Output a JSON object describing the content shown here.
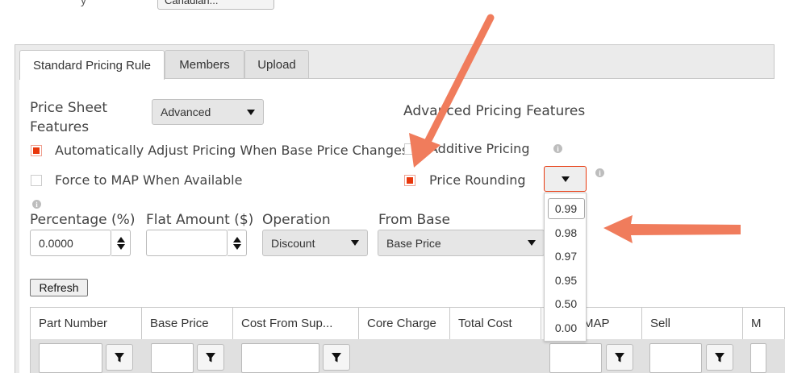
{
  "top": {
    "select_value": "Canadian..."
  },
  "tabs": [
    {
      "label": "Standard Pricing Rule",
      "active": true
    },
    {
      "label": "Members",
      "active": false
    },
    {
      "label": "Upload",
      "active": false
    }
  ],
  "price_sheet": {
    "label_line1": "Price Sheet",
    "label_line2": "Features",
    "select_value": "Advanced"
  },
  "checkboxes": {
    "auto_adjust": {
      "label": "Automatically Adjust Pricing When Base Price Changes",
      "checked": true
    },
    "force_map": {
      "label": "Force to MAP When Available",
      "checked": false
    }
  },
  "advanced": {
    "heading": "Advanced Pricing Features",
    "additive": {
      "label": "Additive Pricing",
      "checked": false
    },
    "rounding": {
      "label": "Price Rounding",
      "checked": true,
      "select_value": ""
    }
  },
  "rounding_options": [
    "0.99",
    "0.98",
    "0.97",
    "0.95",
    "0.50",
    "0.00"
  ],
  "fields": {
    "percentage": {
      "label": "Percentage (%)",
      "value": "0.0000"
    },
    "flat_amount": {
      "label": "Flat Amount ($)",
      "value": ""
    },
    "operation": {
      "label": "Operation",
      "value": "Discount"
    },
    "from_base": {
      "label": "From Base",
      "value": "Base Price"
    }
  },
  "refresh_label": "Refresh",
  "grid": {
    "columns": [
      "Part Number",
      "Base Price",
      "Cost From Sup...",
      "Core Charge",
      "Total Cost",
      "MAP",
      "Sell",
      "M"
    ]
  },
  "colors": {
    "accent": "#e8380d",
    "arrow": "#f07c5c"
  },
  "icons": {
    "caret": "chevron-down-icon",
    "filter": "filter-icon",
    "info": "info-icon"
  }
}
